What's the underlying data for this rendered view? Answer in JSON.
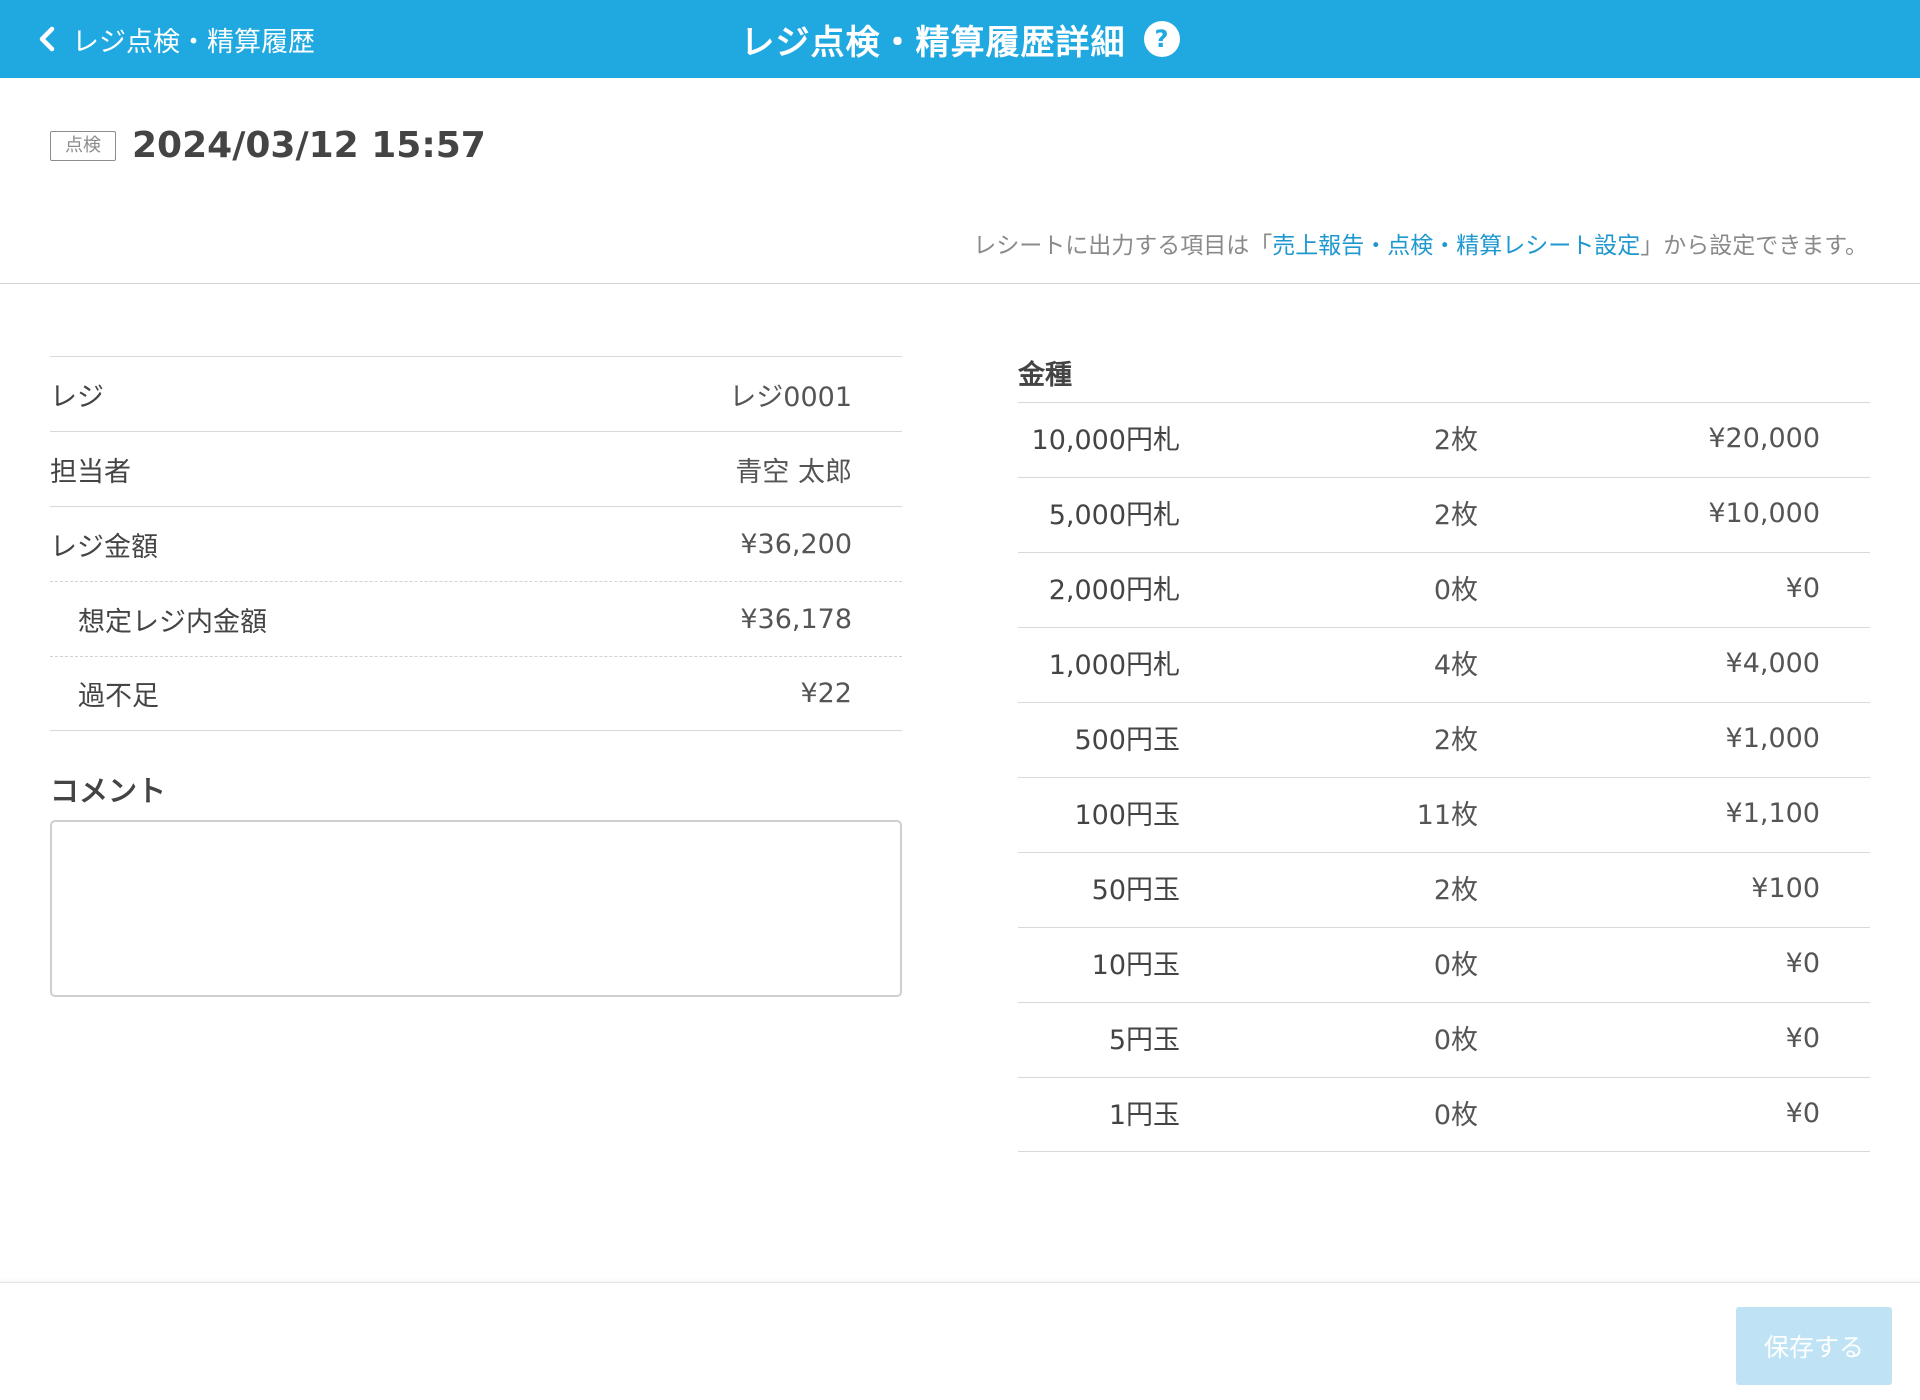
{
  "header": {
    "back_label": "レジ点検・精算履歴",
    "title": "レジ点検・精算履歴詳細",
    "help_symbol": "?"
  },
  "record": {
    "type_badge": "点検",
    "datetime": "2024/03/12 15:57"
  },
  "receipt_note": {
    "prefix": "レシートに出力する項目は「",
    "link": "売上報告・点検・精算レシート設定",
    "suffix": "」から設定できます。"
  },
  "info": [
    {
      "label": "レジ",
      "value": "レジ0001"
    },
    {
      "label": "担当者",
      "value": "青空 太郎"
    },
    {
      "label": "レジ金額",
      "value": "¥36,200"
    },
    {
      "label": "想定レジ内金額",
      "value": "¥36,178"
    },
    {
      "label": "過不足",
      "value": "¥22"
    }
  ],
  "comment": {
    "title": "コメント",
    "value": ""
  },
  "denominations": {
    "title": "金種",
    "rows": [
      {
        "name": "10,000円札",
        "count": "2枚",
        "amount": "¥20,000"
      },
      {
        "name": "5,000円札",
        "count": "2枚",
        "amount": "¥10,000"
      },
      {
        "name": "2,000円札",
        "count": "0枚",
        "amount": "¥0"
      },
      {
        "name": "1,000円札",
        "count": "4枚",
        "amount": "¥4,000"
      },
      {
        "name": "500円玉",
        "count": "2枚",
        "amount": "¥1,000"
      },
      {
        "name": "100円玉",
        "count": "11枚",
        "amount": "¥1,100"
      },
      {
        "name": "50円玉",
        "count": "2枚",
        "amount": "¥100"
      },
      {
        "name": "10円玉",
        "count": "0枚",
        "amount": "¥0"
      },
      {
        "name": "5円玉",
        "count": "0枚",
        "amount": "¥0"
      },
      {
        "name": "1円玉",
        "count": "0枚",
        "amount": "¥0"
      }
    ]
  },
  "footer": {
    "save_label": "保存する"
  },
  "colors": {
    "header_bg": "#20a9e1",
    "link": "#1f98cf",
    "save_disabled_bg": "#bfe3f4"
  }
}
